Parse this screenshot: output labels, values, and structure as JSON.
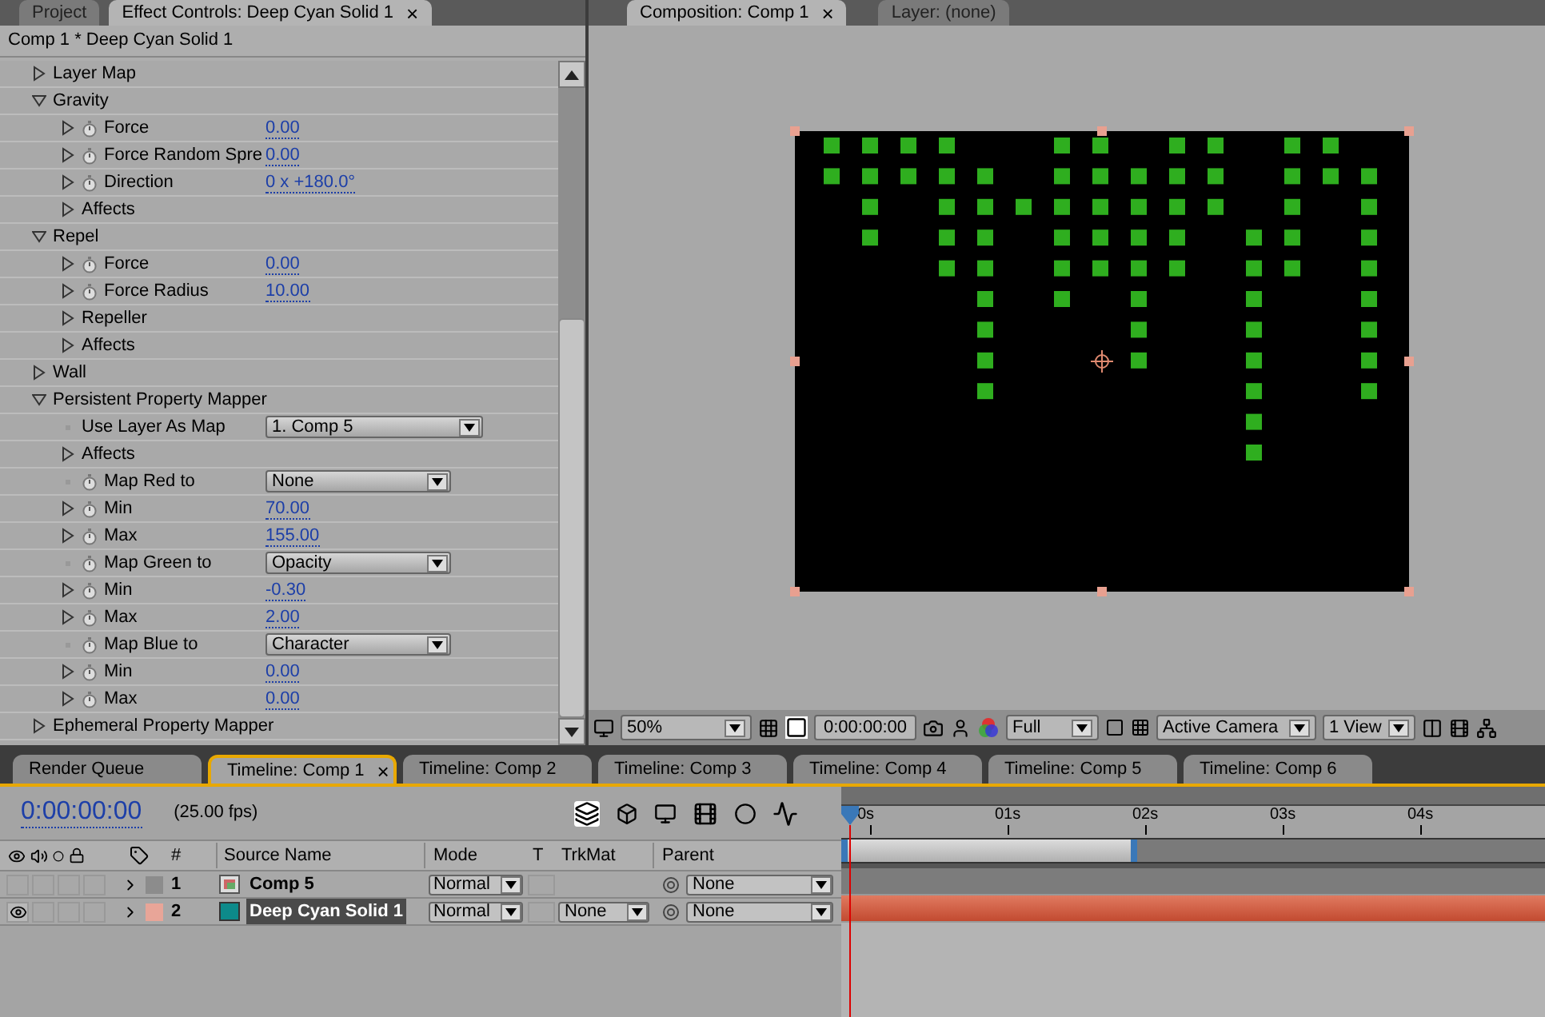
{
  "effect_panel": {
    "tabs": [
      {
        "label": "Project",
        "selected": false
      },
      {
        "label": "Effect Controls: Deep Cyan Solid 1",
        "selected": true,
        "close": "×"
      }
    ],
    "subtitle": "Comp 1 * Deep Cyan Solid 1",
    "properties": [
      {
        "kind": "group",
        "label": "Layer Map",
        "expanded": false
      },
      {
        "kind": "group",
        "label": "Gravity",
        "expanded": true,
        "children": [
          {
            "kind": "value",
            "label": "Force",
            "expanded": false,
            "stopwatch": true,
            "value": "0.00"
          },
          {
            "kind": "value",
            "label": "Force Random Spre",
            "expanded": false,
            "stopwatch": true,
            "value": "0.00"
          },
          {
            "kind": "value",
            "label": "Direction",
            "expanded": false,
            "stopwatch": true,
            "value": "0 x +180.0°"
          },
          {
            "kind": "group",
            "label": "Affects",
            "expanded": false
          }
        ]
      },
      {
        "kind": "group",
        "label": "Repel",
        "expanded": true,
        "children": [
          {
            "kind": "value",
            "label": "Force",
            "expanded": false,
            "stopwatch": true,
            "value": "0.00"
          },
          {
            "kind": "value",
            "label": "Force Radius",
            "expanded": false,
            "stopwatch": true,
            "value": "10.00"
          },
          {
            "kind": "group",
            "label": "Repeller",
            "expanded": false
          },
          {
            "kind": "group",
            "label": "Affects",
            "expanded": false
          }
        ]
      },
      {
        "kind": "group",
        "label": "Wall",
        "expanded": false
      },
      {
        "kind": "group",
        "label": "Persistent Property Mapper",
        "expanded": true,
        "children": [
          {
            "kind": "dropdown",
            "label": "Use Layer As Map",
            "value": "1. Comp 5"
          },
          {
            "kind": "group",
            "label": "Affects",
            "expanded": false
          },
          {
            "kind": "dropdown",
            "label": "Map Red to",
            "stopwatch": true,
            "value": "None"
          },
          {
            "kind": "value",
            "label": "Min",
            "expanded": false,
            "stopwatch": true,
            "value": "70.00"
          },
          {
            "kind": "value",
            "label": "Max",
            "expanded": false,
            "stopwatch": true,
            "value": "155.00"
          },
          {
            "kind": "dropdown",
            "label": "Map Green to",
            "stopwatch": true,
            "value": "Opacity"
          },
          {
            "kind": "value",
            "label": "Min",
            "expanded": false,
            "stopwatch": true,
            "value": "-0.30"
          },
          {
            "kind": "value",
            "label": "Max",
            "expanded": false,
            "stopwatch": true,
            "value": "2.00"
          },
          {
            "kind": "dropdown",
            "label": "Map Blue to",
            "stopwatch": true,
            "value": "Character"
          },
          {
            "kind": "value",
            "label": "Min",
            "expanded": false,
            "stopwatch": true,
            "value": "0.00"
          },
          {
            "kind": "value",
            "label": "Max",
            "expanded": false,
            "stopwatch": true,
            "value": "0.00"
          }
        ]
      },
      {
        "kind": "group",
        "label": "Ephemeral Property Mapper",
        "expanded": false
      }
    ]
  },
  "composition_panel": {
    "tabs": [
      {
        "label": "Composition: Comp 1",
        "selected": true,
        "close": "×"
      },
      {
        "label": "Layer: (none)",
        "selected": false
      }
    ],
    "toolbar": {
      "zoom": "50%",
      "time": "0:00:00:00",
      "resolution": "Full",
      "camera": "Active Camera",
      "views": "1 View"
    }
  },
  "timeline": {
    "tabs": [
      {
        "label": "Render Queue",
        "selected": false
      },
      {
        "label": "Timeline: Comp 1",
        "selected": true,
        "close": "×"
      },
      {
        "label": "Timeline: Comp 2",
        "selected": false
      },
      {
        "label": "Timeline: Comp 3",
        "selected": false
      },
      {
        "label": "Timeline: Comp 4",
        "selected": false
      },
      {
        "label": "Timeline: Comp 5",
        "selected": false
      },
      {
        "label": "Timeline: Comp 6",
        "selected": false
      }
    ],
    "time": "0:00:00:00",
    "fps": "(25.00 fps)",
    "columns": [
      "#",
      "Source Name",
      "Mode",
      "T",
      "TrkMat",
      "Parent"
    ],
    "layers": [
      {
        "number": "1",
        "name": "Comp 5",
        "kind": "comp",
        "visible": false,
        "color": "#8c8c8c",
        "selected": false,
        "mode": "Normal",
        "parent": "None"
      },
      {
        "number": "2",
        "name": "Deep Cyan Solid 1",
        "kind": "solid",
        "visible": true,
        "color": "#e8a598",
        "selected": true,
        "mode": "Normal",
        "trkmat": "None",
        "parent": "None"
      }
    ],
    "ruler": [
      "0s",
      "01s",
      "02s",
      "03s",
      "04s"
    ],
    "work_area": {
      "level": 0.42
    }
  }
}
